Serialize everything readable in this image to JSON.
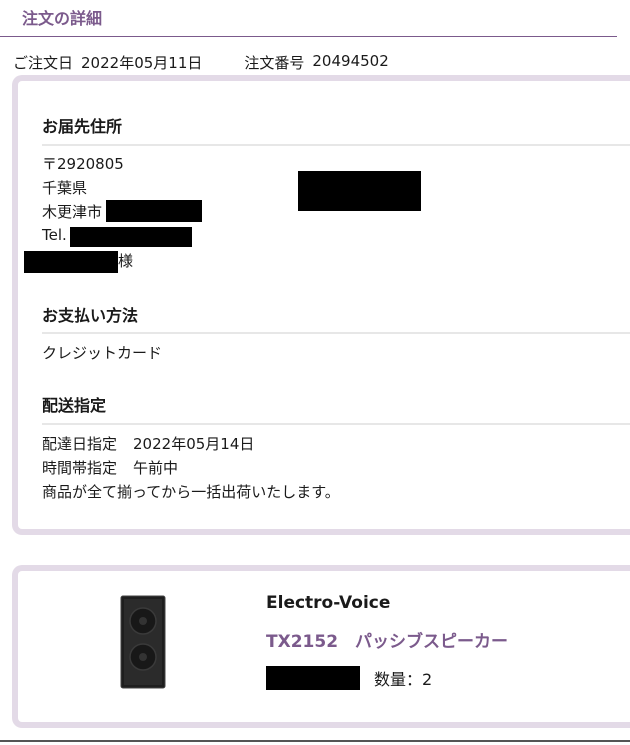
{
  "page": {
    "title": "注文の詳細",
    "order_date_label": "ご注文日",
    "order_date": "2022年05月11日",
    "order_number_label": "注文番号",
    "order_number": "20494502"
  },
  "shipping_address": {
    "heading": "お届先住所",
    "postal_code": "〒2920805",
    "prefecture": "千葉県",
    "city": "木更津市",
    "tel_label": "Tel.",
    "honorific": "様"
  },
  "payment": {
    "heading": "お支払い方法",
    "method": "クレジットカード"
  },
  "delivery": {
    "heading": "配送指定",
    "date_label": "配達日指定",
    "date": "2022年05月14日",
    "time_label": "時間帯指定",
    "time": "午前中",
    "note": "商品が全て揃ってから一括出荷いたします。"
  },
  "product": {
    "brand": "Electro-Voice",
    "name": "TX2152　パッシブスピーカー",
    "quantity_label": "数量：",
    "quantity": "2",
    "image_icon": "speaker-image"
  },
  "colors": {
    "accent": "#7b5a8c",
    "card_border": "#e3dae7"
  }
}
